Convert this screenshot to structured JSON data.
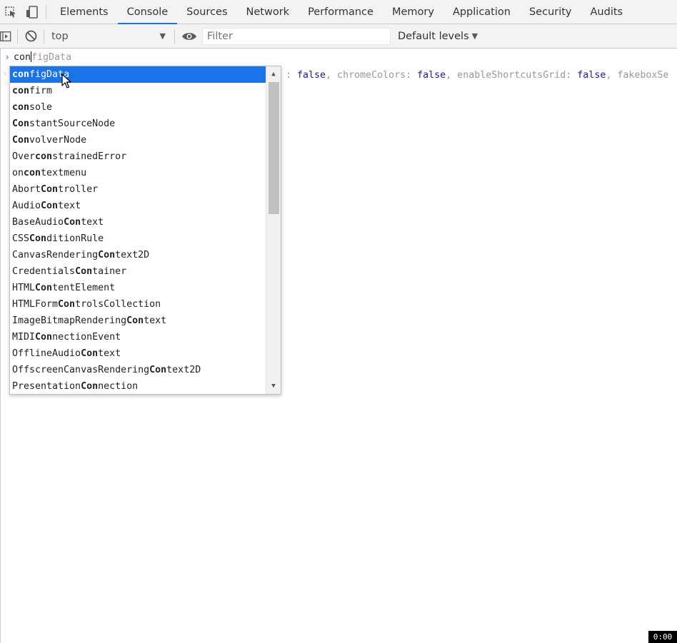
{
  "tabbar": {
    "inspect_icon": "inspect-element-icon",
    "device_icon": "device-toolbar-icon",
    "tabs": [
      {
        "label": "Elements"
      },
      {
        "label": "Console",
        "active": true
      },
      {
        "label": "Sources"
      },
      {
        "label": "Network"
      },
      {
        "label": "Performance"
      },
      {
        "label": "Memory"
      },
      {
        "label": "Application"
      },
      {
        "label": "Security"
      },
      {
        "label": "Audits"
      }
    ]
  },
  "toolbar": {
    "sidebar_icon": "show-sidebar-icon",
    "clear_icon": "clear-console-icon",
    "context_value": "top",
    "eye_icon": "live-expression-eye-icon",
    "filter_placeholder": "Filter",
    "levels_label": "Default levels"
  },
  "console": {
    "prompt_typed": "con",
    "prompt_ghost": "figData",
    "result_segments": [
      {
        "text": ": ",
        "kw": false
      },
      {
        "text": "false",
        "kw": true
      },
      {
        "text": ", chromeColors: ",
        "kw": false
      },
      {
        "text": "false",
        "kw": true
      },
      {
        "text": ", enableShortcutsGrid: ",
        "kw": false
      },
      {
        "text": "false",
        "kw": true
      },
      {
        "text": ", fakeboxSe",
        "kw": false
      }
    ]
  },
  "autocomplete": {
    "selected_index": 0,
    "items": [
      {
        "pre": "",
        "match": "con",
        "post": "figData"
      },
      {
        "pre": "",
        "match": "con",
        "post": "firm"
      },
      {
        "pre": "",
        "match": "con",
        "post": "sole"
      },
      {
        "pre": "",
        "match": "Con",
        "post": "stantSourceNode"
      },
      {
        "pre": "",
        "match": "Con",
        "post": "volverNode"
      },
      {
        "pre": "Over",
        "match": "con",
        "post": "strainedError"
      },
      {
        "pre": "on",
        "match": "con",
        "post": "textmenu"
      },
      {
        "pre": "Abort",
        "match": "Con",
        "post": "troller"
      },
      {
        "pre": "Audio",
        "match": "Con",
        "post": "text"
      },
      {
        "pre": "BaseAudio",
        "match": "Con",
        "post": "text"
      },
      {
        "pre": "CSS",
        "match": "Con",
        "post": "ditionRule"
      },
      {
        "pre": "CanvasRendering",
        "match": "Con",
        "post": "text2D"
      },
      {
        "pre": "Credentials",
        "match": "Con",
        "post": "tainer"
      },
      {
        "pre": "HTML",
        "match": "Con",
        "post": "tentElement"
      },
      {
        "pre": "HTMLForm",
        "match": "Con",
        "post": "trolsCollection"
      },
      {
        "pre": "ImageBitmapRendering",
        "match": "Con",
        "post": "text"
      },
      {
        "pre": "MIDI",
        "match": "Con",
        "post": "nectionEvent"
      },
      {
        "pre": "OfflineAudio",
        "match": "Con",
        "post": "text"
      },
      {
        "pre": "OffscreenCanvasRendering",
        "match": "Con",
        "post": "text2D"
      },
      {
        "pre": "Presentation",
        "match": "Con",
        "post": "nection"
      }
    ]
  },
  "recording_badge": "0:00",
  "colors": {
    "accent": "#1a73e8",
    "panel_bg": "#f3f3f3",
    "keyword": "#1a1aa6"
  }
}
